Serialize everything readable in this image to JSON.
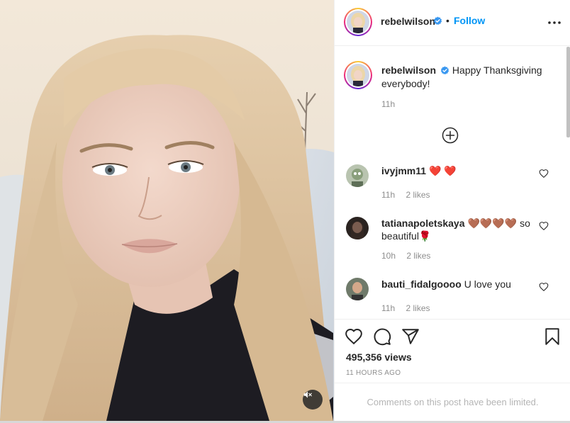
{
  "post": {
    "author": "rebelwilson",
    "verified": true,
    "separator": "•",
    "follow_label": "Follow",
    "more_icon": "more-horizontal-icon"
  },
  "caption": {
    "username": "rebelwilson",
    "text": "Happy Thanksgiving everybody!",
    "time": "11h"
  },
  "comments": [
    {
      "username": "ivyjmm11",
      "text": "❤️ ❤️",
      "time": "11h",
      "likes": "2 likes"
    },
    {
      "username": "tatianapoletskaya",
      "text": "🤎🤎🤎🤎 so beautiful🌹",
      "time": "10h",
      "likes": "2 likes"
    },
    {
      "username": "bauti_fidalgoooo",
      "text": "U love you",
      "time": "11h",
      "likes": "2 likes"
    }
  ],
  "stats": {
    "views": "495,356 views",
    "timestamp": "11 HOURS AGO"
  },
  "footer": {
    "limited_text": "Comments on this post have been limited."
  },
  "colors": {
    "link_blue": "#0095f6",
    "verified_blue": "#3897f0",
    "muted_text": "#8e8e8e",
    "border": "#efefef"
  }
}
